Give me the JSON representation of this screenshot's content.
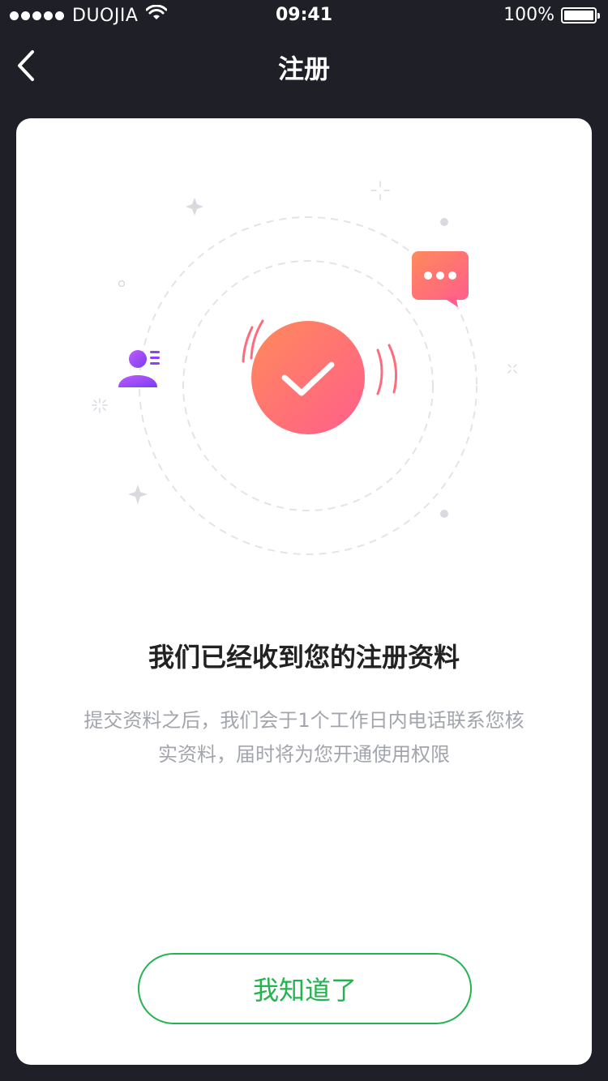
{
  "status_bar": {
    "carrier": "DUOJIA",
    "time": "09:41",
    "battery": "100%"
  },
  "nav": {
    "title": "注册",
    "back_icon": "chevron-left-icon"
  },
  "illustration": {
    "center_icon": "check-icon",
    "left_icon": "user-card-icon",
    "right_icon": "chat-bubble-icon",
    "accent_gradient": [
      "#ff8a5b",
      "#ff5e8a"
    ],
    "user_gradient": [
      "#b35bff",
      "#7a3cf0"
    ]
  },
  "content": {
    "headline": "我们已经收到您的注册资料",
    "description": "提交资料之后，我们会于1个工作日内电话联系您核实资料，届时将为您开通使用权限"
  },
  "actions": {
    "ack_label": "我知道了",
    "accent_color": "#23b44f"
  }
}
